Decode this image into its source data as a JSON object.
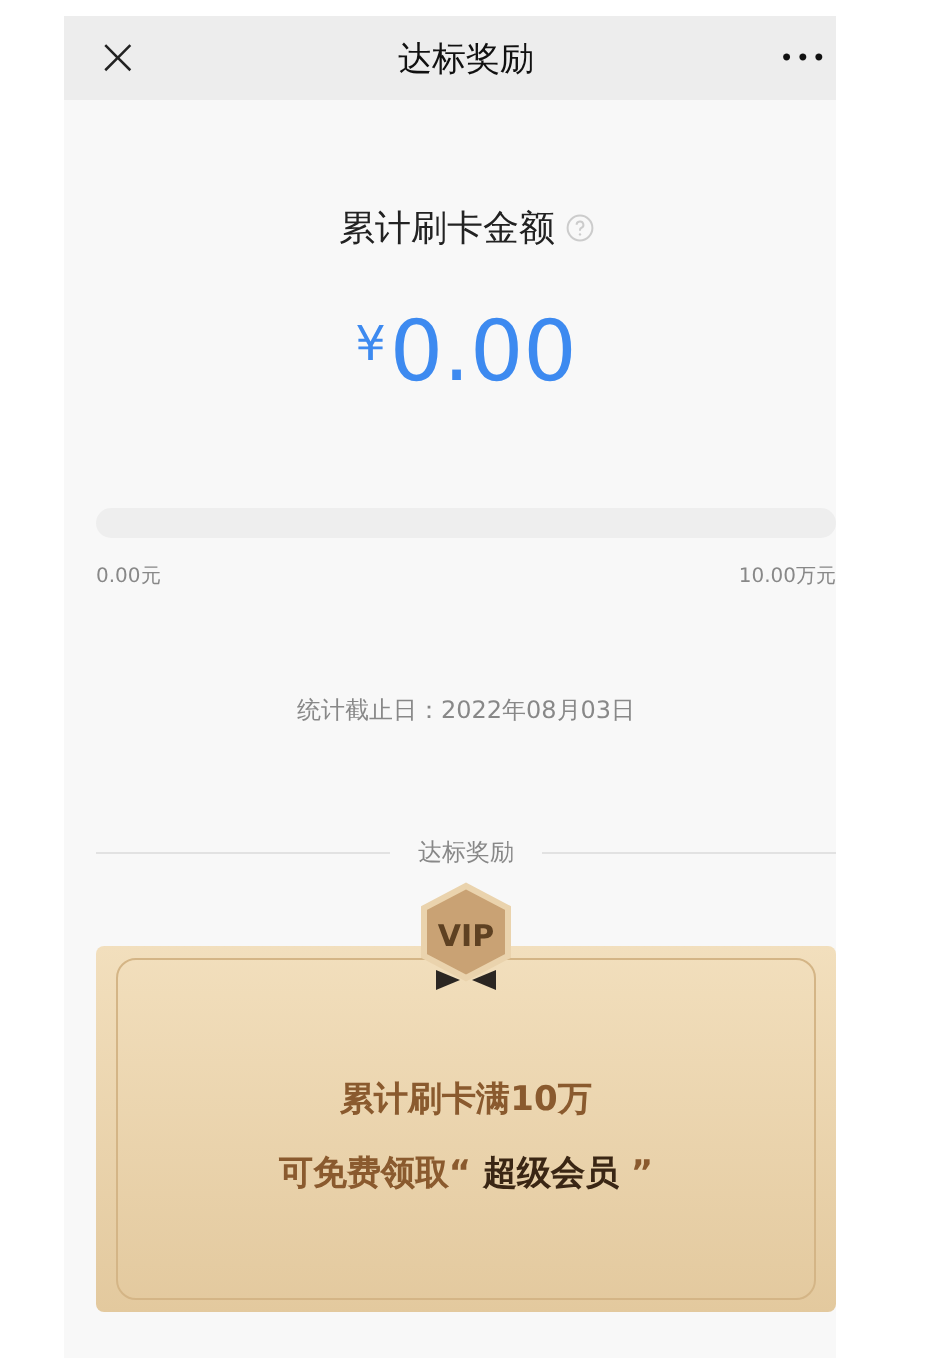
{
  "nav": {
    "close": "×",
    "title": "达标奖励",
    "more": "•••"
  },
  "summary": {
    "label": "累计刷卡金额",
    "currency": "¥",
    "amount": "0.00"
  },
  "progress": {
    "level": 0,
    "min_label": "0.00元",
    "max_label": "10.00万元"
  },
  "date_line": "统计截止日：2022年08月03日",
  "section_title": "达标奖励",
  "reward": {
    "badge": "VIP",
    "line_1": "累计刷卡满10万",
    "line_2": "可免费领取“ **超级会员** ”"
  }
}
